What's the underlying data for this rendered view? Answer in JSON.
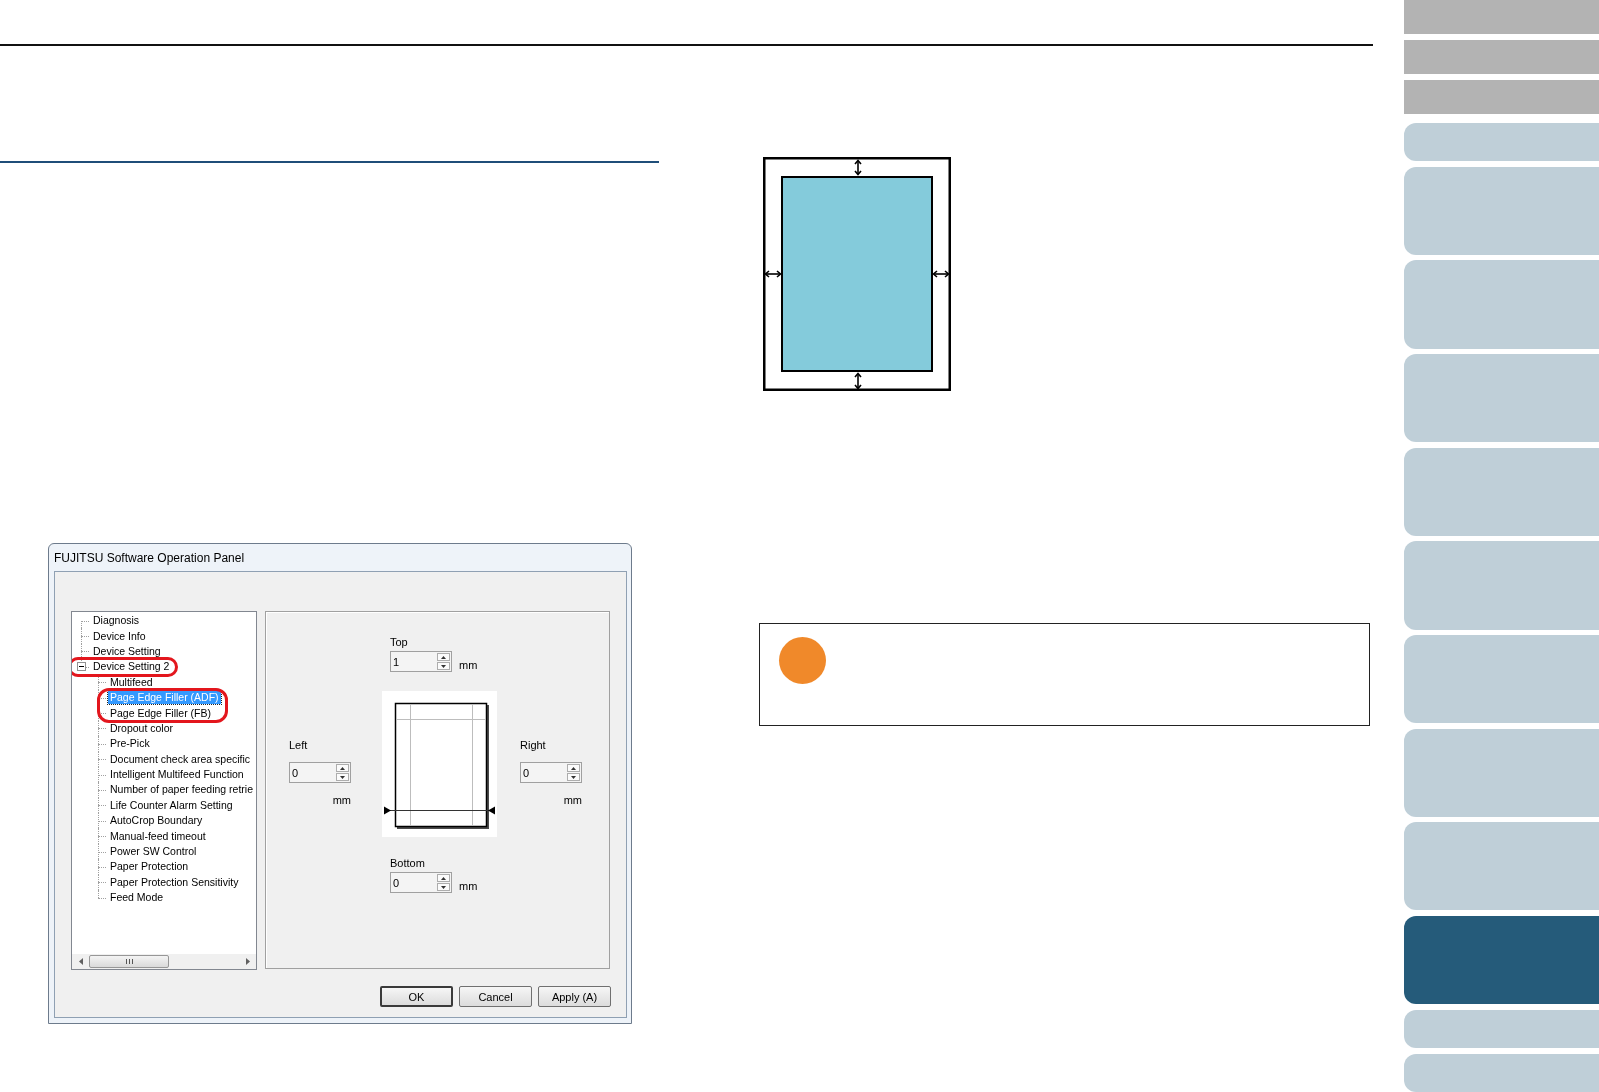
{
  "dialog": {
    "title": "FUJITSU Software Operation Panel",
    "tree": [
      {
        "label": "Diagnosis",
        "selected": false,
        "circled": false
      },
      {
        "label": "Device Info",
        "selected": false,
        "circled": false
      },
      {
        "label": "Device Setting",
        "selected": false,
        "circled": false
      },
      {
        "label": "Device Setting 2",
        "selected": false,
        "circled": true,
        "expanded": true,
        "children": [
          {
            "label": "Multifeed",
            "selected": false,
            "circled": false
          },
          {
            "label": "Page Edge Filler (ADF)",
            "selected": true,
            "circled": true
          },
          {
            "label": "Page Edge Filler (FB)",
            "selected": false,
            "circled": true
          },
          {
            "label": "Dropout color",
            "selected": false,
            "circled": false
          },
          {
            "label": "Pre-Pick",
            "selected": false,
            "circled": false
          },
          {
            "label": "Document check area specific",
            "selected": false,
            "circled": false
          },
          {
            "label": "Intelligent Multifeed Function",
            "selected": false,
            "circled": false
          },
          {
            "label": "Number of paper feeding retrie",
            "selected": false,
            "circled": false
          },
          {
            "label": "Life Counter Alarm Setting",
            "selected": false,
            "circled": false
          },
          {
            "label": "AutoCrop Boundary",
            "selected": false,
            "circled": false
          },
          {
            "label": "Manual-feed timeout",
            "selected": false,
            "circled": false
          },
          {
            "label": "Power SW Control",
            "selected": false,
            "circled": false
          },
          {
            "label": "Paper Protection",
            "selected": false,
            "circled": false
          },
          {
            "label": "Paper Protection Sensitivity",
            "selected": false,
            "circled": false
          },
          {
            "label": "Feed Mode",
            "selected": false,
            "circled": false
          }
        ]
      }
    ],
    "margins": {
      "top": {
        "label": "Top",
        "value": "1",
        "unit": "mm"
      },
      "left": {
        "label": "Left",
        "value": "0",
        "unit": "mm"
      },
      "right": {
        "label": "Right",
        "value": "0",
        "unit": "mm"
      },
      "bottom": {
        "label": "Bottom",
        "value": "0",
        "unit": "mm"
      }
    },
    "buttons": [
      {
        "label": "OK",
        "default": true
      },
      {
        "label": "Cancel",
        "default": false
      },
      {
        "label": "Apply (A)",
        "default": false
      }
    ]
  },
  "note": {
    "kind": "attention"
  },
  "side_tabs": [
    {
      "kind": "index",
      "selected": false
    },
    {
      "kind": "index",
      "selected": false
    },
    {
      "kind": "index",
      "selected": false
    },
    {
      "kind": "short",
      "selected": false
    },
    {
      "kind": "tall",
      "selected": false
    },
    {
      "kind": "tall",
      "selected": false
    },
    {
      "kind": "tall",
      "selected": false
    },
    {
      "kind": "tall",
      "selected": false
    },
    {
      "kind": "tall",
      "selected": false
    },
    {
      "kind": "tall",
      "selected": false
    },
    {
      "kind": "tall",
      "selected": false
    },
    {
      "kind": "tall",
      "selected": false
    },
    {
      "kind": "tall",
      "selected": true
    },
    {
      "kind": "short",
      "selected": false
    },
    {
      "kind": "short",
      "selected": false
    }
  ]
}
